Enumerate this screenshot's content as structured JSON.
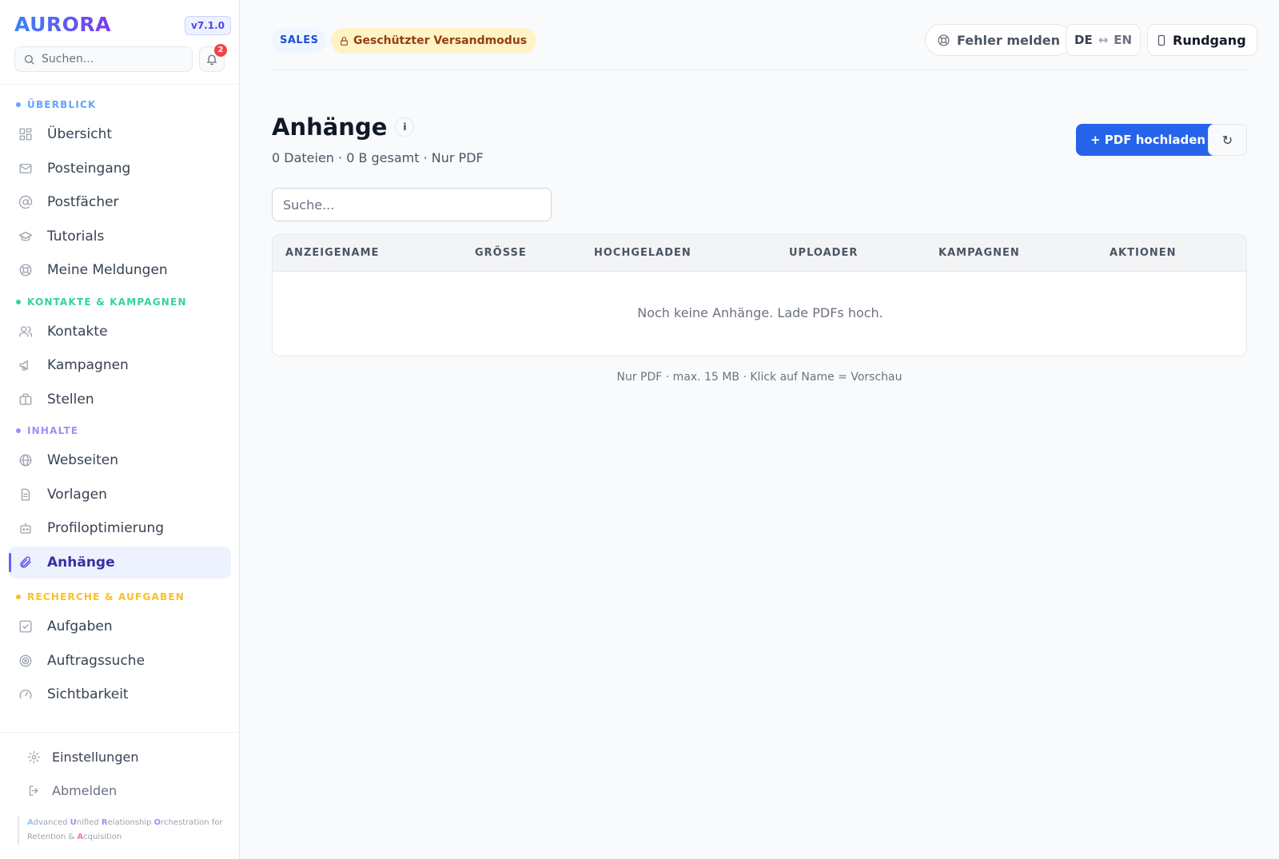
{
  "brand": {
    "logo": "AURORA",
    "version": "v7.1.0"
  },
  "sidebar": {
    "search_placeholder": "Suchen...",
    "notification_count": "2",
    "sections": [
      {
        "label": "ÜBERBLICK",
        "color": "#60a5fa"
      },
      {
        "label": "KONTAKTE & KAMPAGNEN",
        "color": "#34d399"
      },
      {
        "label": "INHALTE",
        "color": "#a78bfa"
      },
      {
        "label": "RECHERCHE & AUFGABEN",
        "color": "#fbbf24"
      }
    ],
    "items": [
      {
        "label": "Übersicht",
        "icon": "grid-icon"
      },
      {
        "label": "Posteingang",
        "icon": "mail-icon"
      },
      {
        "label": "Postfächer",
        "icon": "at-icon"
      },
      {
        "label": "Tutorials",
        "icon": "graduation-cap-icon"
      },
      {
        "label": "Meine Meldungen",
        "icon": "lifebuoy-icon"
      },
      {
        "label": "Kontakte",
        "icon": "users-icon"
      },
      {
        "label": "Kampagnen",
        "icon": "megaphone-icon"
      },
      {
        "label": "Stellen",
        "icon": "briefcase-icon"
      },
      {
        "label": "Webseiten",
        "icon": "globe-icon"
      },
      {
        "label": "Vorlagen",
        "icon": "document-icon"
      },
      {
        "label": "Profiloptimierung",
        "icon": "robot-icon"
      },
      {
        "label": "Anhänge",
        "icon": "paperclip-icon",
        "active": true
      },
      {
        "label": "Aufgaben",
        "icon": "checkbox-icon"
      },
      {
        "label": "Auftragssuche",
        "icon": "target-icon"
      },
      {
        "label": "Sichtbarkeit",
        "icon": "gauge-icon"
      }
    ],
    "footer": {
      "settings": "Einstellungen",
      "logout": "Abmelden",
      "tagline": [
        {
          "initial": "A",
          "rest": "dvanced "
        },
        {
          "initial": "U",
          "rest": "nified "
        },
        {
          "initial": "R",
          "rest": "elationship "
        },
        {
          "initial": "O",
          "rest": "rchestration for "
        },
        {
          "initial": "",
          "rest": "Retention & "
        },
        {
          "initial": "A",
          "rest": "cquisition"
        }
      ]
    }
  },
  "topbar": {
    "mode_badge": "SALES",
    "protected_badge": "Geschützter Versandmodus",
    "report_button": "Fehler melden",
    "lang_from": "DE",
    "lang_arrow": "↔",
    "lang_to": "EN",
    "tour_button": "Rundgang"
  },
  "main": {
    "title": "Anhänge",
    "info": "i",
    "subtitle": "0 Dateien · 0 B gesamt · Nur PDF",
    "upload_button": "+ PDF hochladen",
    "refresh_glyph": "↻",
    "search_placeholder": "Suche...",
    "table": {
      "columns": [
        "ANZEIGENAME",
        "GRÖSSE",
        "HOCHGELADEN",
        "UPLOADER",
        "KAMPAGNEN",
        "AKTIONEN"
      ],
      "empty_text": "Noch keine Anhänge. Lade PDFs hoch."
    },
    "hint": "Nur PDF · max. 15 MB · Klick auf Name = Vorschau"
  },
  "colors": {
    "accent": "#2563eb",
    "active_bg": "#eef2ff",
    "warning_bg": "#fef3c7",
    "badge": "#ef4444"
  }
}
